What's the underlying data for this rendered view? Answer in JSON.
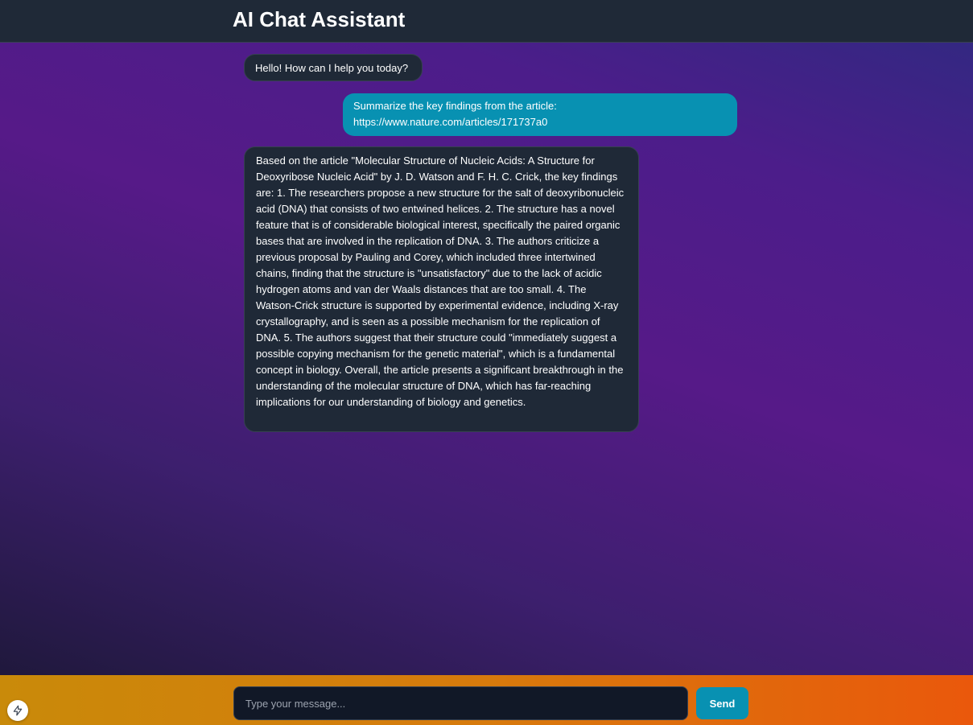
{
  "header": {
    "title": "AI Chat Assistant"
  },
  "messages": [
    {
      "role": "assistant",
      "text": "Hello! How can I help you today?"
    },
    {
      "role": "user",
      "text": "Summarize the key findings from the article: https://www.nature.com/articles/171737a0"
    },
    {
      "role": "assistant",
      "text": "Based on the article \"Molecular Structure of Nucleic Acids: A Structure for Deoxyribose Nucleic Acid\" by J. D. Watson and F. H. C. Crick, the key findings are: 1. The researchers propose a new structure for the salt of deoxyribonucleic acid (DNA) that consists of two entwined helices. 2. The structure has a novel feature that is of considerable biological interest, specifically the paired organic bases that are involved in the replication of DNA. 3. The authors criticize a previous proposal by Pauling and Corey, which included three intertwined chains, finding that the structure is \"unsatisfactory\" due to the lack of acidic hydrogen atoms and van der Waals distances that are too small. 4. The Watson-Crick structure is supported by experimental evidence, including X-ray crystallography, and is seen as a possible mechanism for the replication of DNA. 5. The authors suggest that their structure could \"immediately suggest a possible copying mechanism for the genetic material\", which is a fundamental concept in biology. Overall, the article presents a significant breakthrough in the understanding of the molecular structure of DNA, which has far-reaching implications for our understanding of biology and genetics."
    }
  ],
  "composer": {
    "input_value": "",
    "placeholder": "Type your message...",
    "send_label": "Send"
  },
  "badge": {
    "icon": "lightning-bolt-icon"
  },
  "colors": {
    "header_bg": "#1f2937",
    "assistant_bubble": "#1f2937",
    "user_bubble": "#0891b2",
    "send_button": "#0891b2",
    "input_bg": "#111827",
    "composer_gradient_start": "#c98a0a",
    "composer_gradient_end": "#ea580c",
    "background_purple": "#561a88"
  }
}
